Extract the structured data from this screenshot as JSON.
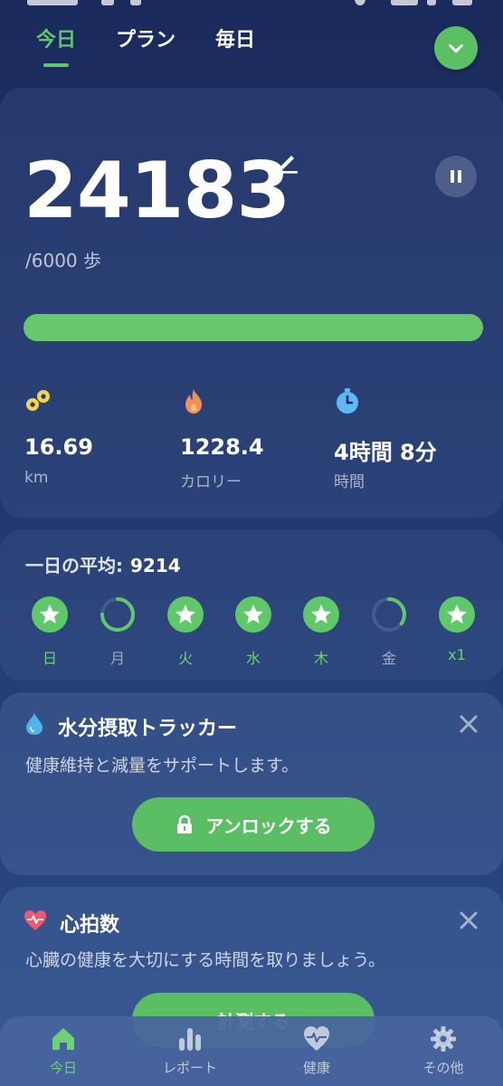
{
  "top_tabs": {
    "today": "今日",
    "plan": "プラン",
    "daily": "毎日"
  },
  "steps": {
    "count": "24183",
    "goal_text": "/6000 歩",
    "progress_percent": 100
  },
  "stats": {
    "distance": {
      "value": "16.69",
      "unit": "km",
      "icon": "route-icon"
    },
    "calories": {
      "value": "1228.4",
      "unit": "カロリー",
      "icon": "flame-icon"
    },
    "time": {
      "value": "4時間 8分",
      "unit": "時間",
      "icon": "stopwatch-icon"
    }
  },
  "average": {
    "label": "一日の平均:",
    "value": "9214",
    "days": [
      {
        "label": "日",
        "state": "done"
      },
      {
        "label": "月",
        "state": "partial",
        "fraction": 0.75
      },
      {
        "label": "火",
        "state": "done"
      },
      {
        "label": "水",
        "state": "done"
      },
      {
        "label": "木",
        "state": "done"
      },
      {
        "label": "金",
        "state": "partial",
        "fraction": 0.35
      },
      {
        "label": "x1",
        "state": "done"
      }
    ]
  },
  "water_card": {
    "title": "水分摂取トラッカー",
    "description": "健康維持と減量をサポートします。",
    "button": "アンロックする"
  },
  "heart_card": {
    "title": "心拍数",
    "description": "心臓の健康を大切にする時間を取りましょう。",
    "button": "計測する"
  },
  "bottom_nav": {
    "today": "今日",
    "report": "レポート",
    "health": "健康",
    "other": "その他"
  },
  "colors": {
    "accent": "#5fc868",
    "background_top": "#1b2a5c",
    "background_bottom": "#2a4b85"
  }
}
